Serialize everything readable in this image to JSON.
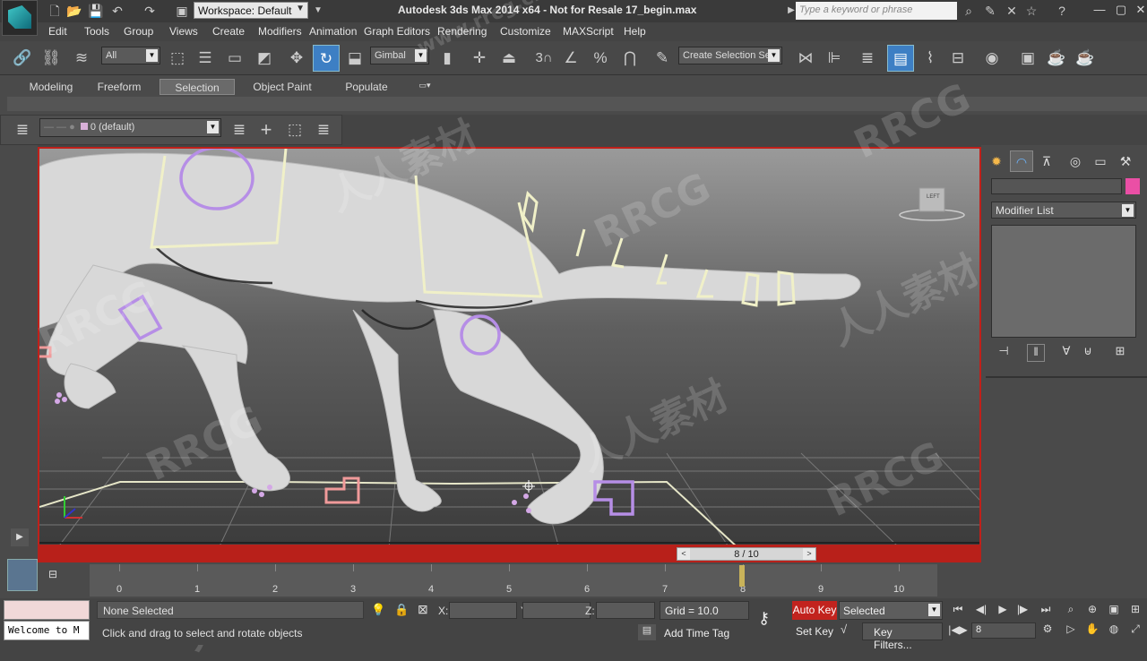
{
  "title_bar": {
    "title": "Autodesk 3ds Max  2014 x64  - Not for Resale   17_begin.max",
    "workspace": "Workspace: Default",
    "search_placeholder": "Type a keyword or phrase"
  },
  "menu": [
    "Edit",
    "Tools",
    "Group",
    "Views",
    "Create",
    "Modifiers",
    "Animation",
    "Graph Editors",
    "Rendering",
    "Customize",
    "MAXScript",
    "Help"
  ],
  "toolbar": {
    "selection_filter": "All",
    "ref_coord": "Gimbal",
    "snap_label": "3",
    "selection_set_placeholder": "Create Selection Se"
  },
  "ribbon_tabs": [
    "Modeling",
    "Freeform",
    "Selection",
    "Object Paint",
    "Populate"
  ],
  "ribbon_active": "Selection",
  "layer": {
    "name": "0 (default)"
  },
  "viewport": {
    "gizmo_label": "LEFT"
  },
  "time_slider": {
    "label": "8 / 10",
    "prev": "<",
    "next": ">",
    "current_frame": 8,
    "total_frames": 10
  },
  "timeline_ticks": [
    "0",
    "1",
    "2",
    "3",
    "4",
    "5",
    "6",
    "7",
    "8",
    "9",
    "10"
  ],
  "command_panel": {
    "modifier_list": "Modifier List",
    "name_color": "#ea4fa5"
  },
  "status": {
    "selection": "None Selected",
    "prompt": "Click and drag to select and rotate objects",
    "maxscript_text": "Welcome to M",
    "x_label": "X:",
    "y_label": "Y:",
    "z_label": "Z:",
    "grid": "Grid = 10.0",
    "add_time_tag": "Add Time Tag"
  },
  "animation": {
    "auto_key": "Auto Key",
    "set_key": "Set Key",
    "selected_mode": "Selected",
    "key_filters": "Key Filters...",
    "frame": "8"
  },
  "colors": {
    "autokey_red": "#c2231e",
    "viewport_border": "#c0201a",
    "active_tool": "#3d7fc4"
  },
  "watermark": [
    "RRCG",
    "人人素材",
    "www.rrcg.cn"
  ]
}
